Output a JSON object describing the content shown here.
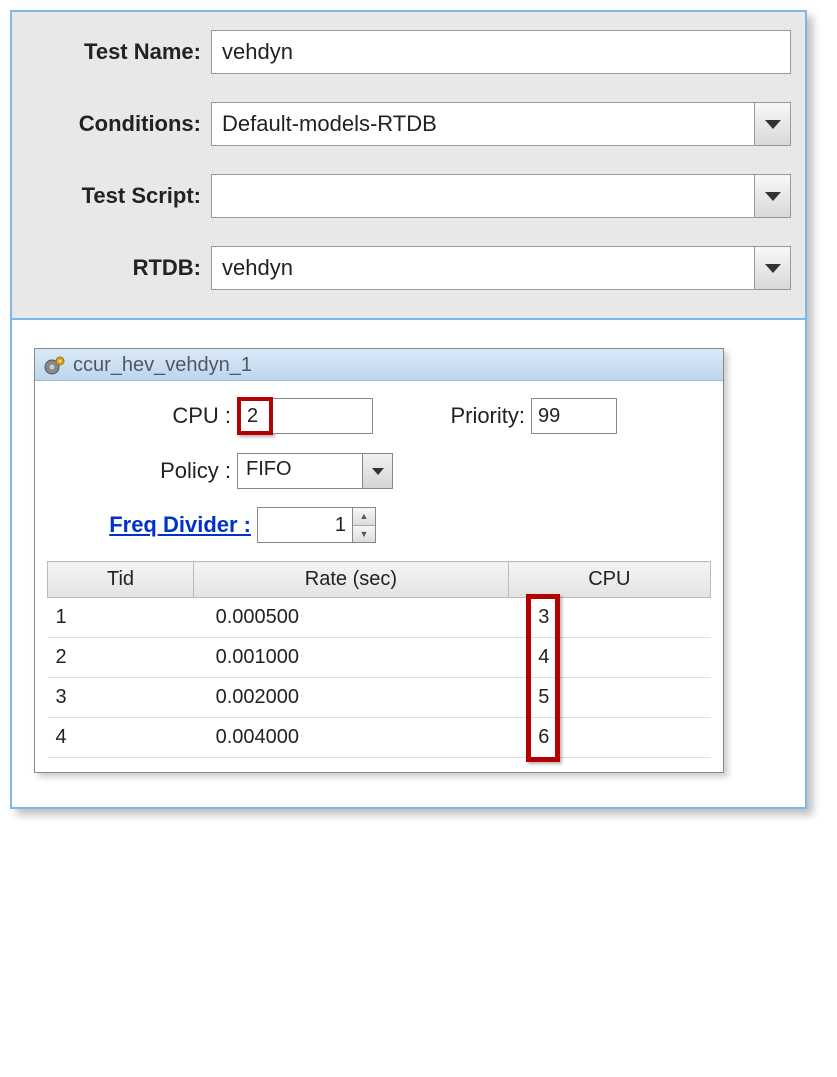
{
  "form": {
    "test_name_label": "Test Name:",
    "test_name_value": "vehdyn",
    "conditions_label": "Conditions:",
    "conditions_value": "Default-models-RTDB",
    "test_script_label": "Test Script:",
    "test_script_value": "",
    "rtdb_label": "RTDB:",
    "rtdb_value": "vehdyn"
  },
  "panel": {
    "title": "ccur_hev_vehdyn_1",
    "cpu_label": "CPU :",
    "cpu_value": "2",
    "priority_label": "Priority:",
    "priority_value": "99",
    "policy_label": "Policy :",
    "policy_value": "FIFO",
    "freq_label": "Freq Divider :",
    "freq_value": "1",
    "table": {
      "headers": {
        "tid": "Tid",
        "rate": "Rate (sec)",
        "cpu": "CPU"
      },
      "rows": [
        {
          "tid": "1",
          "rate": "0.000500",
          "cpu": "3"
        },
        {
          "tid": "2",
          "rate": "0.001000",
          "cpu": "4"
        },
        {
          "tid": "3",
          "rate": "0.002000",
          "cpu": "5"
        },
        {
          "tid": "4",
          "rate": "0.004000",
          "cpu": "6"
        }
      ]
    }
  }
}
